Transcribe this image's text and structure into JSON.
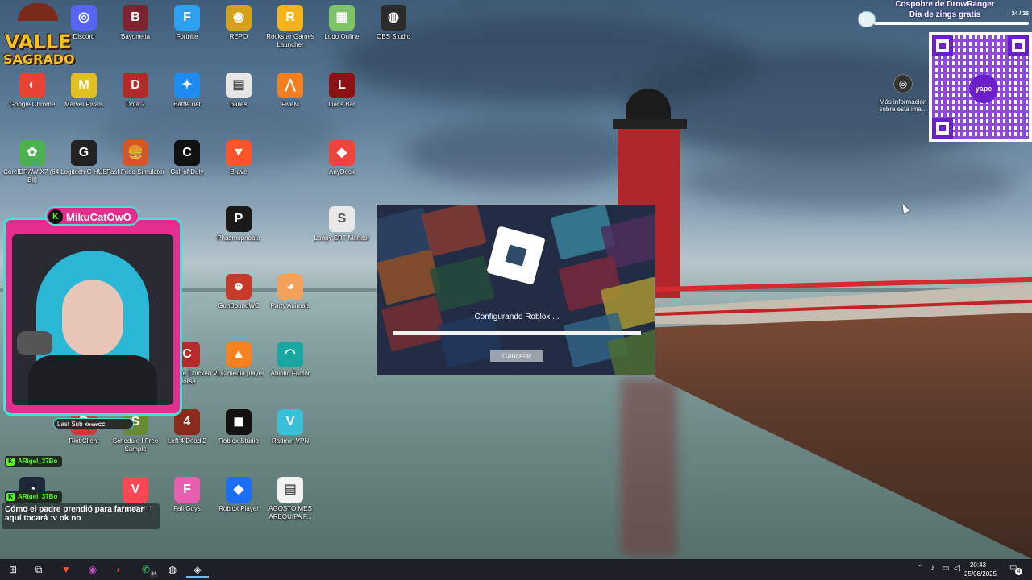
{
  "desktop": {
    "icons": [
      {
        "label": "Discord",
        "glyph": "◎",
        "color": "#5865f2"
      },
      {
        "label": "Bayonetta",
        "glyph": "B",
        "color": "#7a2430"
      },
      {
        "label": "Fortnite",
        "glyph": "F",
        "color": "#2fa0f0"
      },
      {
        "label": "REPO",
        "glyph": "◉",
        "color": "#d4a21a"
      },
      {
        "label": "Rockstar Games Launcher",
        "glyph": "R",
        "color": "#f4b41a"
      },
      {
        "label": "Ludo Online",
        "glyph": "▦",
        "color": "#7cc36a"
      },
      {
        "label": "OBS Studio",
        "glyph": "◍",
        "color": "#2b2b2b"
      },
      {
        "label": "Google Chrome",
        "glyph": "◐",
        "color": "#e84235"
      },
      {
        "label": "Marvel Rivals",
        "glyph": "M",
        "color": "#e0c120"
      },
      {
        "label": "Dota 2",
        "glyph": "D",
        "color": "#b02a2a"
      },
      {
        "label": "Battle.net",
        "glyph": "✦",
        "color": "#1f8cf3"
      },
      {
        "label": "bailes",
        "glyph": "▤",
        "color": "#e6e6e6"
      },
      {
        "label": "FiveM",
        "glyph": "⋀",
        "color": "#f57e20"
      },
      {
        "label": "Liar's Bar",
        "glyph": "L",
        "color": "#8a1212"
      },
      {
        "label": "CorelDRAW X7 (64-Bit)",
        "glyph": "✿",
        "color": "#4caf50"
      },
      {
        "label": "Logitech G HUB",
        "glyph": "G",
        "color": "#222"
      },
      {
        "label": "Fast Food Simulator",
        "glyph": "🍔",
        "color": "#d1562b"
      },
      {
        "label": "Call of Duty",
        "glyph": "C",
        "color": "#111"
      },
      {
        "label": "Brave",
        "glyph": "▼",
        "color": "#fb542b"
      },
      {
        "label": "AnyDesk",
        "glyph": "◆",
        "color": "#ef443b"
      },
      {
        "label": "Phasmophobia",
        "glyph": "P",
        "color": "#1a1a1a"
      },
      {
        "label": "Loopy SRT Monitor",
        "glyph": "S",
        "color": "#e8e8e8"
      },
      {
        "label": "GunBoundWC",
        "glyph": "☻",
        "color": "#c53a2a"
      },
      {
        "label": "Party Animals",
        "glyph": "◕",
        "color": "#f2a25a"
      },
      {
        "label": "Ultimate Chicken Horse",
        "glyph": "C",
        "color": "#b62a2a"
      },
      {
        "label": "VLC media player",
        "glyph": "▲",
        "color": "#f7811e"
      },
      {
        "label": "Abiotic Factor",
        "glyph": "◠",
        "color": "#18a6a0"
      },
      {
        "label": "Riot Client",
        "glyph": "R",
        "color": "#d13639"
      },
      {
        "label": "Schedule I Free Sample",
        "glyph": "S",
        "color": "#6a8b35"
      },
      {
        "label": "Left 4 Dead 2",
        "glyph": "4",
        "color": "#8b2a1a"
      },
      {
        "label": "Roblox Studio",
        "glyph": "◼",
        "color": "#111"
      },
      {
        "label": "Radmin VPN",
        "glyph": "V",
        "color": "#39c0d8"
      },
      {
        "label": "Steam",
        "glyph": "◔",
        "color": "#1b2838"
      },
      {
        "label": "VALORANT",
        "glyph": "V",
        "color": "#ff4655"
      },
      {
        "label": "Fall Guys",
        "glyph": "F",
        "color": "#e65fb0"
      },
      {
        "label": "Roblox Player",
        "glyph": "◆",
        "color": "#1c6ef2"
      },
      {
        "label": "AGOSTO MES AREQUIPA F...",
        "glyph": "▤",
        "color": "#f2f2f2"
      }
    ]
  },
  "dialog": {
    "status": "Configurando Roblox ...",
    "cancel_label": "Cancelar",
    "progress": 1.0
  },
  "overlay": {
    "logo_line1": "VALLE",
    "logo_line2": "SAGRADO",
    "cam_tag": "MikuCatOwO",
    "last_sub_label": "Last Sub",
    "last_sub_name": "XtremCC",
    "kick_user": "ARigel_37Bo",
    "chat_message": "Cómo el padre prendió para farmear aquí tocará :v ok no"
  },
  "top_right": {
    "cosp_line1": "Cospobre de DrowRanger",
    "cosp_line2": "Dia de zings gratis",
    "cosp_count": "24 / 25",
    "yape_label": "yape",
    "more_info": "Más información sobre esta ima..."
  },
  "taskbar": {
    "time": "20:43",
    "date": "25/08/2025",
    "whatsapp_badge": "34",
    "notif_count": "4"
  }
}
